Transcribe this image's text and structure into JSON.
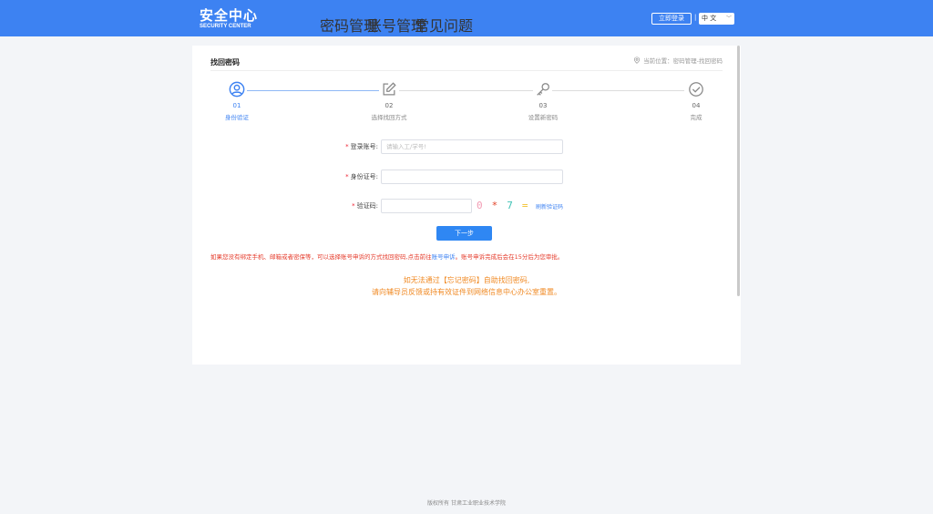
{
  "header": {
    "logo_cn": "安全中心",
    "logo_en": "SECURITY CENTER",
    "nav": [
      "密码管理",
      "账号管理",
      "常见问题"
    ],
    "login": "立即登录",
    "divider": "|",
    "language": "中 文",
    "bg_color": "#3d82f2"
  },
  "card": {
    "title": "找回密码",
    "location": "当前位置：密码管理-找回密码"
  },
  "steps": [
    {
      "num": "01",
      "label": "身份验证",
      "icon": "user-circle-icon",
      "active": true
    },
    {
      "num": "02",
      "label": "选择找回方式",
      "icon": "edit-icon",
      "active": false
    },
    {
      "num": "03",
      "label": "设置新密码",
      "icon": "key-icon",
      "active": false
    },
    {
      "num": "04",
      "label": "完成",
      "icon": "check-circle-icon",
      "active": false
    }
  ],
  "form": {
    "account_label": "登录账号:",
    "account_placeholder": "请输入工/学号!",
    "id_label": "身份证号:",
    "id_value": "",
    "captcha_label": "验证码:",
    "captcha_value": "",
    "captcha_chars": [
      "0",
      "*",
      "7",
      "="
    ],
    "captcha_colors": [
      "#f29bb3",
      "#e2452a",
      "#3fc2b5",
      "#f2c12e"
    ],
    "refresh": "刷新验证码",
    "required_mark": "*",
    "next": "下一步"
  },
  "notice": {
    "red_before": "如果您没有绑定手机、邮箱或者密保等，可以选择账号申诉的方式找回密码,点击前往",
    "red_link": "账号申诉",
    "red_after": "。账号申诉完成后会在15分后为您审批。",
    "orange_line1": "如无法通过【忘记密码】自助找回密码,",
    "orange_line2": "请向辅导员反馈或持有效证件到网络信息中心办公室重置。"
  },
  "footer": "版权所有 甘肃工业职业技术学院"
}
